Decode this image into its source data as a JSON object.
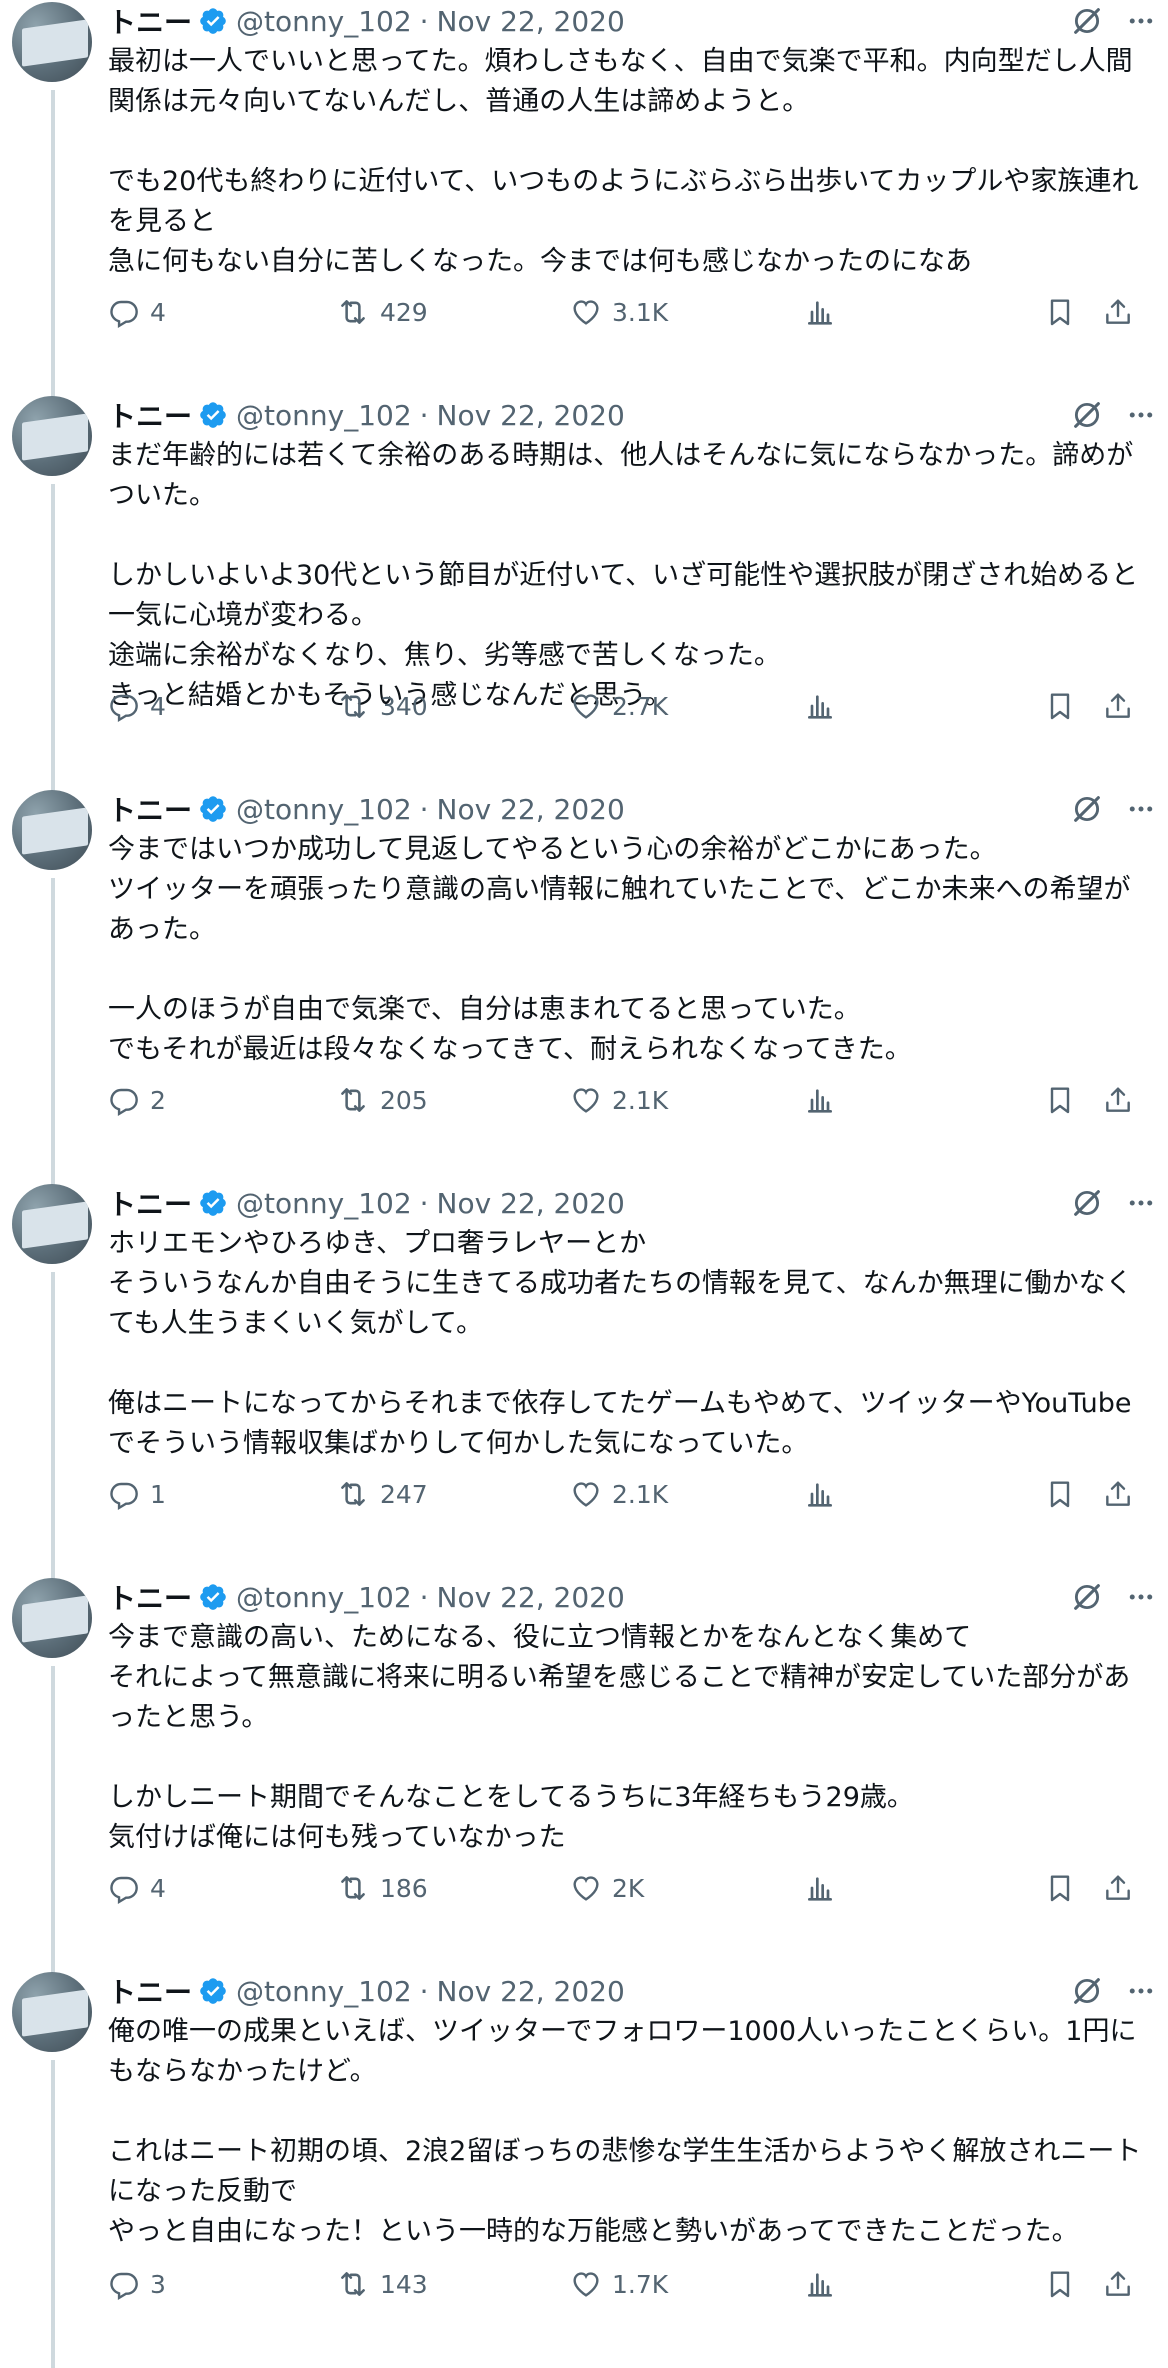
{
  "tweets": [
    {
      "name": "トニー",
      "handle": "@tonny_102",
      "sep": "·",
      "date": "Nov 22, 2020",
      "text": "最初は一人でいいと思ってた。煩わしさもなく、自由で気楽で平和。内向型だし人間関係は元々向いてないんだし、普通の人生は諦めようと。\n\nでも20代も終わりに近付いて、いつものようにぶらぶら出歩いてカップルや家族連れを見ると\n急に何もない自分に苦しくなった。今までは何も感じなかったのになあ",
      "replies": "4",
      "retweets": "429",
      "likes": "3.1K"
    },
    {
      "name": "トニー",
      "handle": "@tonny_102",
      "sep": "·",
      "date": "Nov 22, 2020",
      "text": "まだ年齢的には若くて余裕のある時期は、他人はそんなに気にならなかった。諦めがついた。\n\nしかしいよいよ30代という節目が近付いて、いざ可能性や選択肢が閉ざされ始めると一気に心境が変わる。\n途端に余裕がなくなり、焦り、劣等感で苦しくなった。\nきっと結婚とかもそういう感じなんだと思う。",
      "replies": "4",
      "retweets": "340",
      "likes": "2.7K"
    },
    {
      "name": "トニー",
      "handle": "@tonny_102",
      "sep": "·",
      "date": "Nov 22, 2020",
      "text": "今まではいつか成功して見返してやるという心の余裕がどこかにあった。\nツイッターを頑張ったり意識の高い情報に触れていたことで、どこか未来への希望があった。\n\n一人のほうが自由で気楽で、自分は恵まれてると思っていた。\nでもそれが最近は段々なくなってきて、耐えられなくなってきた。",
      "replies": "2",
      "retweets": "205",
      "likes": "2.1K"
    },
    {
      "name": "トニー",
      "handle": "@tonny_102",
      "sep": "·",
      "date": "Nov 22, 2020",
      "text": "ホリエモンやひろゆき、プロ奢ラレヤーとか\nそういうなんか自由そうに生きてる成功者たちの情報を見て、なんか無理に働かなくても人生うまくいく気がして。\n\n俺はニートになってからそれまで依存してたゲームもやめて、ツイッターやYouTubeでそういう情報収集ばかりして何かした気になっていた。",
      "replies": "1",
      "retweets": "247",
      "likes": "2.1K"
    },
    {
      "name": "トニー",
      "handle": "@tonny_102",
      "sep": "·",
      "date": "Nov 22, 2020",
      "text": "今まで意識の高い、ためになる、役に立つ情報とかをなんとなく集めて\nそれによって無意識に将来に明るい希望を感じることで精神が安定していた部分があったと思う。\n\nしかしニート期間でそんなことをしてるうちに3年経ちもう29歳。\n気付けば俺には何も残っていなかった",
      "replies": "4",
      "retweets": "186",
      "likes": "2K"
    },
    {
      "name": "トニー",
      "handle": "@tonny_102",
      "sep": "·",
      "date": "Nov 22, 2020",
      "text": "俺の唯一の成果といえば、ツイッターでフォロワー1000人いったことくらい。1円にもならなかったけど。\n\nこれはニート初期の頃、2浪2留ぼっちの悲惨な学生生活からようやく解放されニートになった反動で\nやっと自由になった！という一時的な万能感と勢いがあってできたことだった。",
      "replies": "3",
      "retweets": "143",
      "likes": "1.7K"
    }
  ],
  "colors": {
    "text": "#0f1419",
    "secondary": "#536471",
    "verified": "#1d9bf0",
    "thread_line": "#cfd9de"
  },
  "icons": [
    "avatar",
    "verified-badge-icon",
    "grok-icon",
    "more-icon",
    "reply-icon",
    "retweet-icon",
    "like-icon",
    "views-icon",
    "bookmark-icon",
    "share-icon"
  ]
}
